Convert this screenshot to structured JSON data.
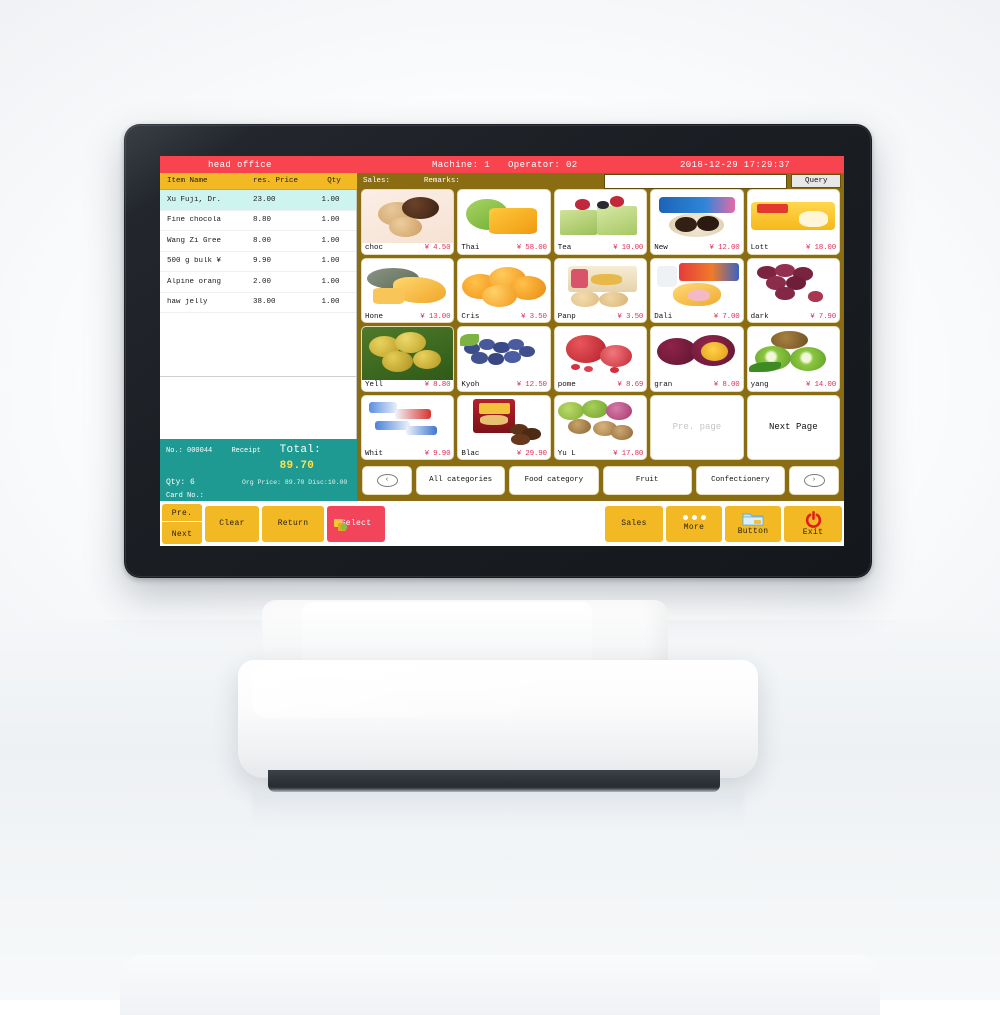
{
  "titlebar": {
    "office": "head office",
    "machine": "Machine: 1",
    "operator": "Operator: 02",
    "datetime": "2018-12-29 17:29:37"
  },
  "order_panel": {
    "columns": [
      "Item Name",
      "res. Price",
      "Qty"
    ],
    "rows": [
      {
        "name": "Xu Fuji, Dr.",
        "price": "23.00",
        "qty": "1.00",
        "selected": true
      },
      {
        "name": "Fine chocola",
        "price": "8.80",
        "qty": "1.00",
        "selected": false
      },
      {
        "name": "Wang Zi Gree",
        "price": "8.00",
        "qty": "1.00",
        "selected": false
      },
      {
        "name": "500 g bulk ¥",
        "price": "9.90",
        "qty": "1.00",
        "selected": false
      },
      {
        "name": "Alpine orang",
        "price": "2.00",
        "qty": "1.00",
        "selected": false
      },
      {
        "name": "haw jelly",
        "price": "38.00",
        "qty": "1.00",
        "selected": false
      }
    ],
    "summary": {
      "no_label": "No.:",
      "no_value": "000044",
      "receipt_label": "Receipt",
      "total_label": "Total:",
      "total_value": "89.70",
      "qty_label": "Qty:",
      "qty_value": "6",
      "org_price": "Org Price: 89.70 Disc:10.00",
      "card_label": "Card No.:"
    }
  },
  "product_panel": {
    "sales_label": "Sales:",
    "remarks_label": "Remarks:",
    "search_value": "",
    "search_placeholder": "",
    "query_label": "Query",
    "currency": "¥",
    "products": [
      {
        "name": "choc",
        "price": "4.50",
        "img": "chocolate-cookies"
      },
      {
        "name": "Thai",
        "price": "58.00",
        "img": "mango"
      },
      {
        "name": "Tea",
        "price": "10.00",
        "img": "matcha-cake"
      },
      {
        "name": "New",
        "price": "12.00",
        "img": "oreo-pack"
      },
      {
        "name": "Lott",
        "price": "18.00",
        "img": "lotte-pack"
      },
      {
        "name": "Hone",
        "price": "13.00",
        "img": "melon"
      },
      {
        "name": "Cris",
        "price": "3.50",
        "img": "oranges"
      },
      {
        "name": "Panp",
        "price": "3.50",
        "img": "bread-box"
      },
      {
        "name": "Dali",
        "price": "7.00",
        "img": "cream-cake"
      },
      {
        "name": "dark",
        "price": "7.90",
        "img": "red-grapes"
      },
      {
        "name": "Yell",
        "price": "8.80",
        "img": "yellow-peach"
      },
      {
        "name": "Kyoh",
        "price": "12.50",
        "img": "blueberries"
      },
      {
        "name": "pome",
        "price": "8.69",
        "img": "pomegranate"
      },
      {
        "name": "gran",
        "price": "8.00",
        "img": "passionfruit"
      },
      {
        "name": "yang",
        "price": "14.00",
        "img": "kiwi"
      },
      {
        "name": "Whit",
        "price": "9.90",
        "img": "white-candy"
      },
      {
        "name": "Blac",
        "price": "29.90",
        "img": "dates-pack"
      },
      {
        "name": "Yu L",
        "price": "17.80",
        "img": "mixed-fruit"
      }
    ],
    "prev_page_label": "Pre. page",
    "next_page_label": "Next Page",
    "prev_page_disabled": true,
    "categories": [
      {
        "label": "‹",
        "type": "arrow-left"
      },
      {
        "label": "All categories",
        "type": "category"
      },
      {
        "label": "Food category",
        "type": "category"
      },
      {
        "label": "Fruit",
        "type": "category"
      },
      {
        "label": "Confectionery",
        "type": "category"
      },
      {
        "label": "›",
        "type": "arrow-right"
      }
    ]
  },
  "toolbar": {
    "pre_label": "Pre.",
    "next_label": "Next",
    "clear_label": "Clear",
    "return_label": "Return",
    "select_label": "Select",
    "sales_label": "Sales",
    "more_label": "More",
    "button_label": "Button",
    "exit_label": "Exit"
  },
  "colors": {
    "titlebar_red": "#f7444e",
    "header_yellow": "#f2b925",
    "summary_teal": "#1f9a92",
    "panel_gold": "#8a6c12",
    "price_red": "#e0315a",
    "select_red": "#f2455c",
    "total_yellow": "#ffe14d",
    "row_selected": "#cdf4ee"
  }
}
